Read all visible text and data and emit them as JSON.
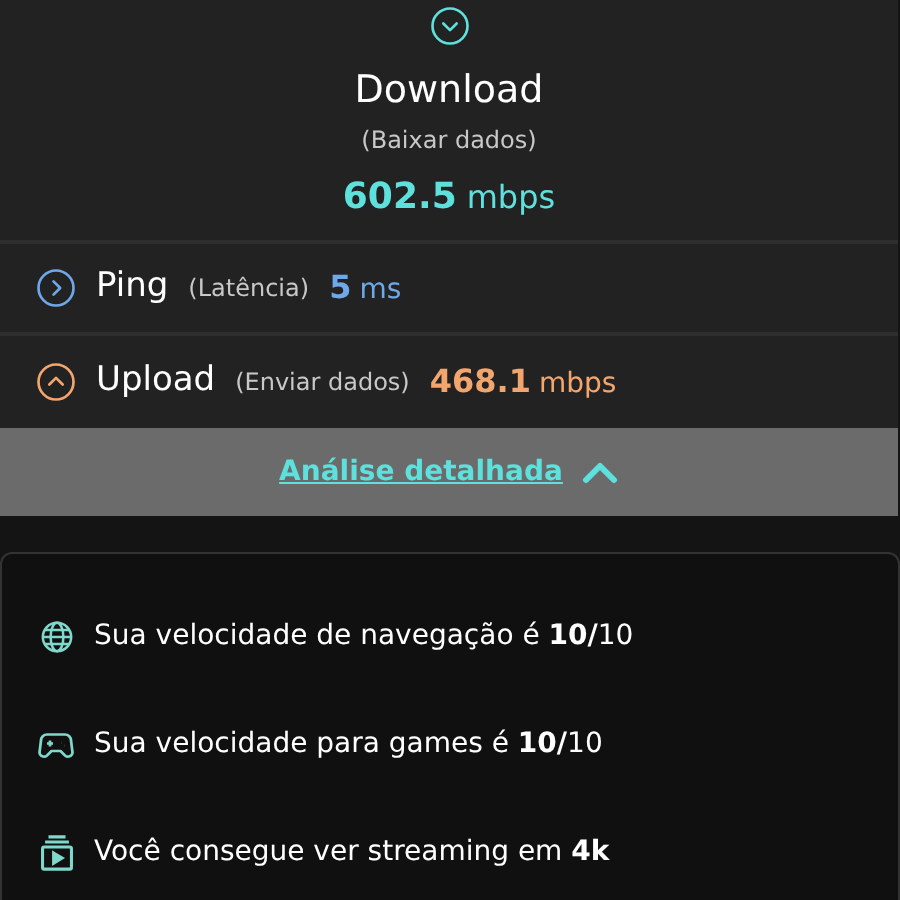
{
  "download": {
    "title": "Download",
    "subtitle": "(Baixar dados)",
    "value": "602.5",
    "unit": "mbps",
    "color": "#5ee0dc"
  },
  "rows": [
    {
      "kind": "ping",
      "title": "Ping",
      "subtitle": "(Latência)",
      "value": "5",
      "unit": "ms",
      "color": "#6fa8e8"
    },
    {
      "kind": "upload",
      "title": "Upload",
      "subtitle": "(Enviar dados)",
      "value": "468.1",
      "unit": "mbps",
      "color": "#f2a66e"
    }
  ],
  "details_link": {
    "label": "Análise detalhada",
    "expanded": true
  },
  "insights": [
    {
      "kind": "globe",
      "text": "Sua velocidade de navegação é **10/**10"
    },
    {
      "kind": "gamepad",
      "text": "Sua velocidade para games é **10/**10"
    },
    {
      "kind": "streaming",
      "text": "Você consegue ver streaming em **4k**"
    }
  ]
}
